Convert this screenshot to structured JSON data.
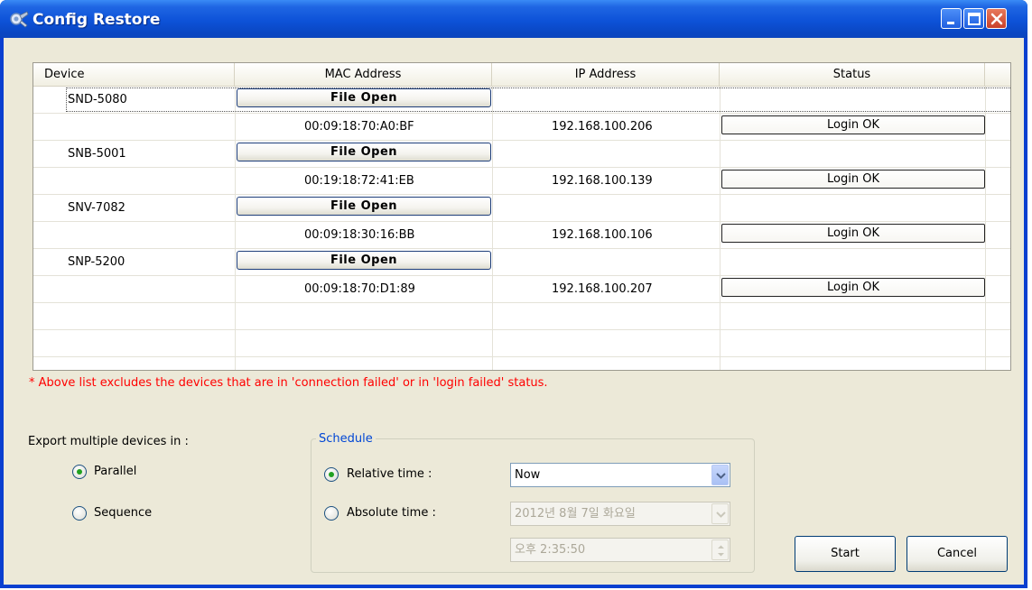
{
  "window": {
    "title": "Config Restore",
    "controls": [
      "minimize-icon",
      "maximize-icon",
      "close-icon"
    ],
    "accent": "#0a47c4"
  },
  "grid": {
    "columns": [
      "Device",
      "MAC Address",
      "IP Address",
      "Status"
    ],
    "rows": [
      {
        "device": "SND-5080",
        "file_button": "File Open",
        "mac": "00:09:18:70:A0:BF",
        "ip": "192.168.100.206",
        "status": "Login OK"
      },
      {
        "device": "SNB-5001",
        "file_button": "File Open",
        "mac": "00:19:18:72:41:EB",
        "ip": "192.168.100.139",
        "status": "Login OK"
      },
      {
        "device": "SNV-7082",
        "file_button": "File Open",
        "mac": "00:09:18:30:16:BB",
        "ip": "192.168.100.106",
        "status": "Login OK"
      },
      {
        "device": "SNP-5200",
        "file_button": "File Open",
        "mac": "00:09:18:70:D1:89",
        "ip": "192.168.100.207",
        "status": "Login OK"
      }
    ]
  },
  "note": "*  Above list excludes the devices that are in 'connection failed' or in 'login failed' status.",
  "export": {
    "label": "Export multiple devices in :",
    "options": [
      "Parallel",
      "Sequence"
    ],
    "selected": "Parallel"
  },
  "schedule": {
    "title": "Schedule",
    "relative_label": "Relative time :",
    "absolute_label": "Absolute time :",
    "selected": "Relative time :",
    "relative_value": "Now",
    "absolute_date": "2012년  8월  7일 화요일",
    "absolute_time": "오후  2:35:50"
  },
  "buttons": {
    "start": "Start",
    "cancel": "Cancel"
  }
}
